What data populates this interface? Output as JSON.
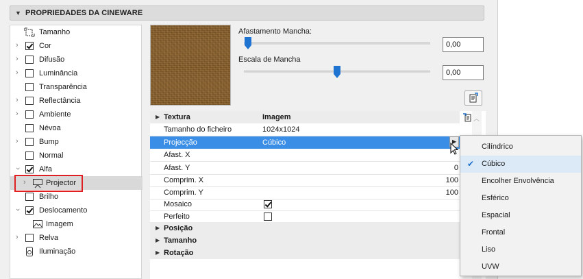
{
  "panel": {
    "title": "PROPRIEDADES DA CINEWARE"
  },
  "tree": {
    "items": [
      {
        "label": "Tamanho",
        "icon": "size-icon",
        "expander": false,
        "checkbox": null
      },
      {
        "label": "Cor",
        "expander": true,
        "checkbox": true
      },
      {
        "label": "Difusão",
        "expander": true,
        "checkbox": false
      },
      {
        "label": "Luminância",
        "expander": true,
        "checkbox": false
      },
      {
        "label": "Transparência",
        "expander": false,
        "checkbox": false
      },
      {
        "label": "Reflectância",
        "expander": true,
        "checkbox": false
      },
      {
        "label": "Ambiente",
        "expander": true,
        "checkbox": false
      },
      {
        "label": "Névoa",
        "expander": false,
        "checkbox": false
      },
      {
        "label": "Bump",
        "expander": true,
        "checkbox": false
      },
      {
        "label": "Normal",
        "expander": false,
        "checkbox": false
      },
      {
        "label": "Alfa",
        "expander": true,
        "checkbox": true,
        "expanded": true
      },
      {
        "label": "Projector",
        "icon": "projector-icon",
        "expander": true,
        "selected": true
      },
      {
        "label": "Brilho",
        "expander": false,
        "checkbox": false
      },
      {
        "label": "Deslocamento",
        "expander": true,
        "checkbox": true,
        "expanded": true
      },
      {
        "label": "Imagem",
        "icon": "image-icon"
      },
      {
        "label": "Relva",
        "expander": true,
        "checkbox": false
      },
      {
        "label": "Iluminação",
        "icon": "illumination-icon"
      }
    ]
  },
  "controls": {
    "offset_label": "Afastamento Mancha:",
    "offset_value": "0,00",
    "offset_slider_fraction": 0.02,
    "scale_label": "Escala de Mancha",
    "scale_value": "0,00",
    "scale_slider_fraction": 0.5
  },
  "table": {
    "header": {
      "key": "Textura",
      "value": "Imagem"
    },
    "rows": [
      {
        "key": "Tamanho do ficheiro",
        "value": "1024x1024"
      },
      {
        "key": "Projecção",
        "value": "Cúbico",
        "selected": true
      },
      {
        "key": "Afast. X",
        "value_right": ""
      },
      {
        "key": "Afast. Y",
        "value_right": "0"
      },
      {
        "key": "Comprim. X",
        "value_right": "100"
      },
      {
        "key": "Comprim. Y",
        "value_right": "100"
      },
      {
        "key": "Mosaico",
        "check": true
      },
      {
        "key": "Perfeito",
        "check": false
      }
    ],
    "groups": [
      "Posição",
      "Tamanho",
      "Rotação"
    ]
  },
  "menu": {
    "items": [
      "Cilíndrico",
      "Cúbico",
      "Encolher Envolvência",
      "Esférico",
      "Espacial",
      "Frontal",
      "Liso",
      "UVW"
    ],
    "checked_index": 1,
    "check_mark": "✔"
  },
  "colors": {
    "selection": "#3a8ee6",
    "highlight_box": "#e02020",
    "checkmark": "#1f6fcf"
  }
}
